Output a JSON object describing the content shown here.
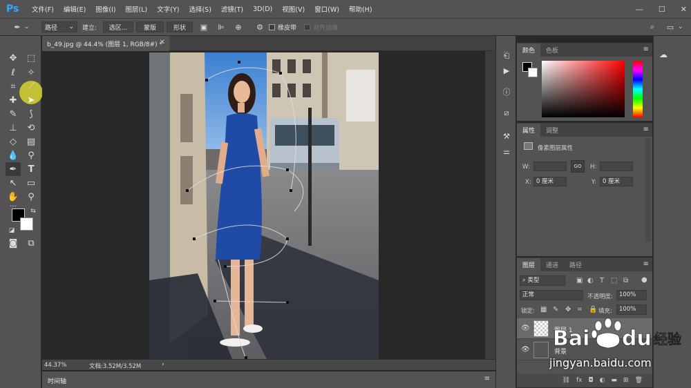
{
  "app": {
    "logo": "Ps"
  },
  "menu": [
    "文件(F)",
    "编辑(E)",
    "图像(I)",
    "图层(L)",
    "文字(Y)",
    "选择(S)",
    "滤镜(T)",
    "3D(D)",
    "视图(V)",
    "窗口(W)",
    "帮助(H)"
  ],
  "window_controls": {
    "minimize": "—",
    "maximize": "☐",
    "close": "✕"
  },
  "options": {
    "mode_select": "路径",
    "build_label": "建立:",
    "selection_btn": "选区...",
    "mask_btn": "蒙版",
    "shape_btn": "形状",
    "rubber_band_label": "橡皮带",
    "auto_add_label": "对齐边缘"
  },
  "doc": {
    "tab_title": "b_49.jpg @ 44.4% (图层 1, RGB/8#) *",
    "zoom": "44.37%",
    "doc_info": "文档:3.52M/3.52M",
    "timeline_label": "时间轴"
  },
  "panels": {
    "color": {
      "tabs": [
        "颜色",
        "色板"
      ]
    },
    "properties": {
      "tabs": [
        "属性",
        "调整"
      ],
      "header": "像素图层属性",
      "w_label": "W:",
      "h_label": "H:",
      "link": "GO",
      "x_label": "X:",
      "x_value": "0 厘米",
      "y_label": "Y:",
      "y_value": "0 厘米"
    },
    "layers": {
      "tabs": [
        "图层",
        "通道",
        "路径"
      ],
      "filter_kind": "类型",
      "blend_mode": "正常",
      "opacity_label": "不透明度:",
      "opacity_value": "100%",
      "lock_label": "锁定:",
      "fill_label": "填充:",
      "fill_value": "100%",
      "items": [
        {
          "name": "图层 1"
        },
        {
          "name": "背景"
        }
      ]
    }
  },
  "watermark": {
    "text": "jingyan.baidu.com",
    "brand": "Bai du 经验"
  },
  "colors": {
    "chrome": "#535353",
    "canvas_bg": "#282828",
    "accent": "#31a8ff",
    "highlight": "#e6e628"
  }
}
